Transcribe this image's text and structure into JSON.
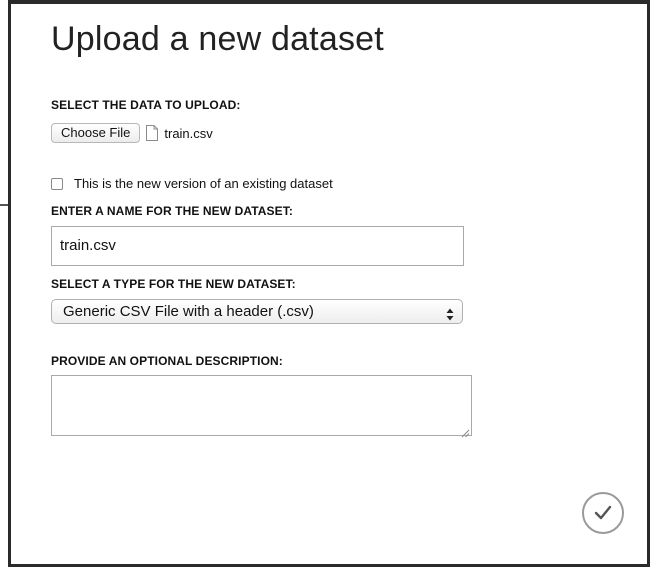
{
  "dialog": {
    "title": "Upload a new dataset",
    "upload_label": "SELECT THE DATA TO UPLOAD:",
    "choose_file_button": "Choose File",
    "selected_file_name": "train.csv",
    "new_version_checkbox": {
      "label": "This is the new version of an existing dataset",
      "checked": false
    },
    "name_label": "ENTER A NAME FOR THE NEW DATASET:",
    "name_value": "train.csv",
    "type_label": "SELECT A TYPE FOR THE NEW DATASET:",
    "type_selected": "Generic CSV File with a header (.csv)",
    "description_label": "PROVIDE AN OPTIONAL DESCRIPTION:",
    "description_value": ""
  },
  "icons": {
    "file": "file-icon",
    "select_arrows": "updown-arrows-icon",
    "confirm": "checkmark-icon"
  },
  "colors": {
    "frame": "#2a2a2a",
    "text": "#111111",
    "border": "#a9a9a9",
    "confirm_ring": "#9a9a9a"
  }
}
